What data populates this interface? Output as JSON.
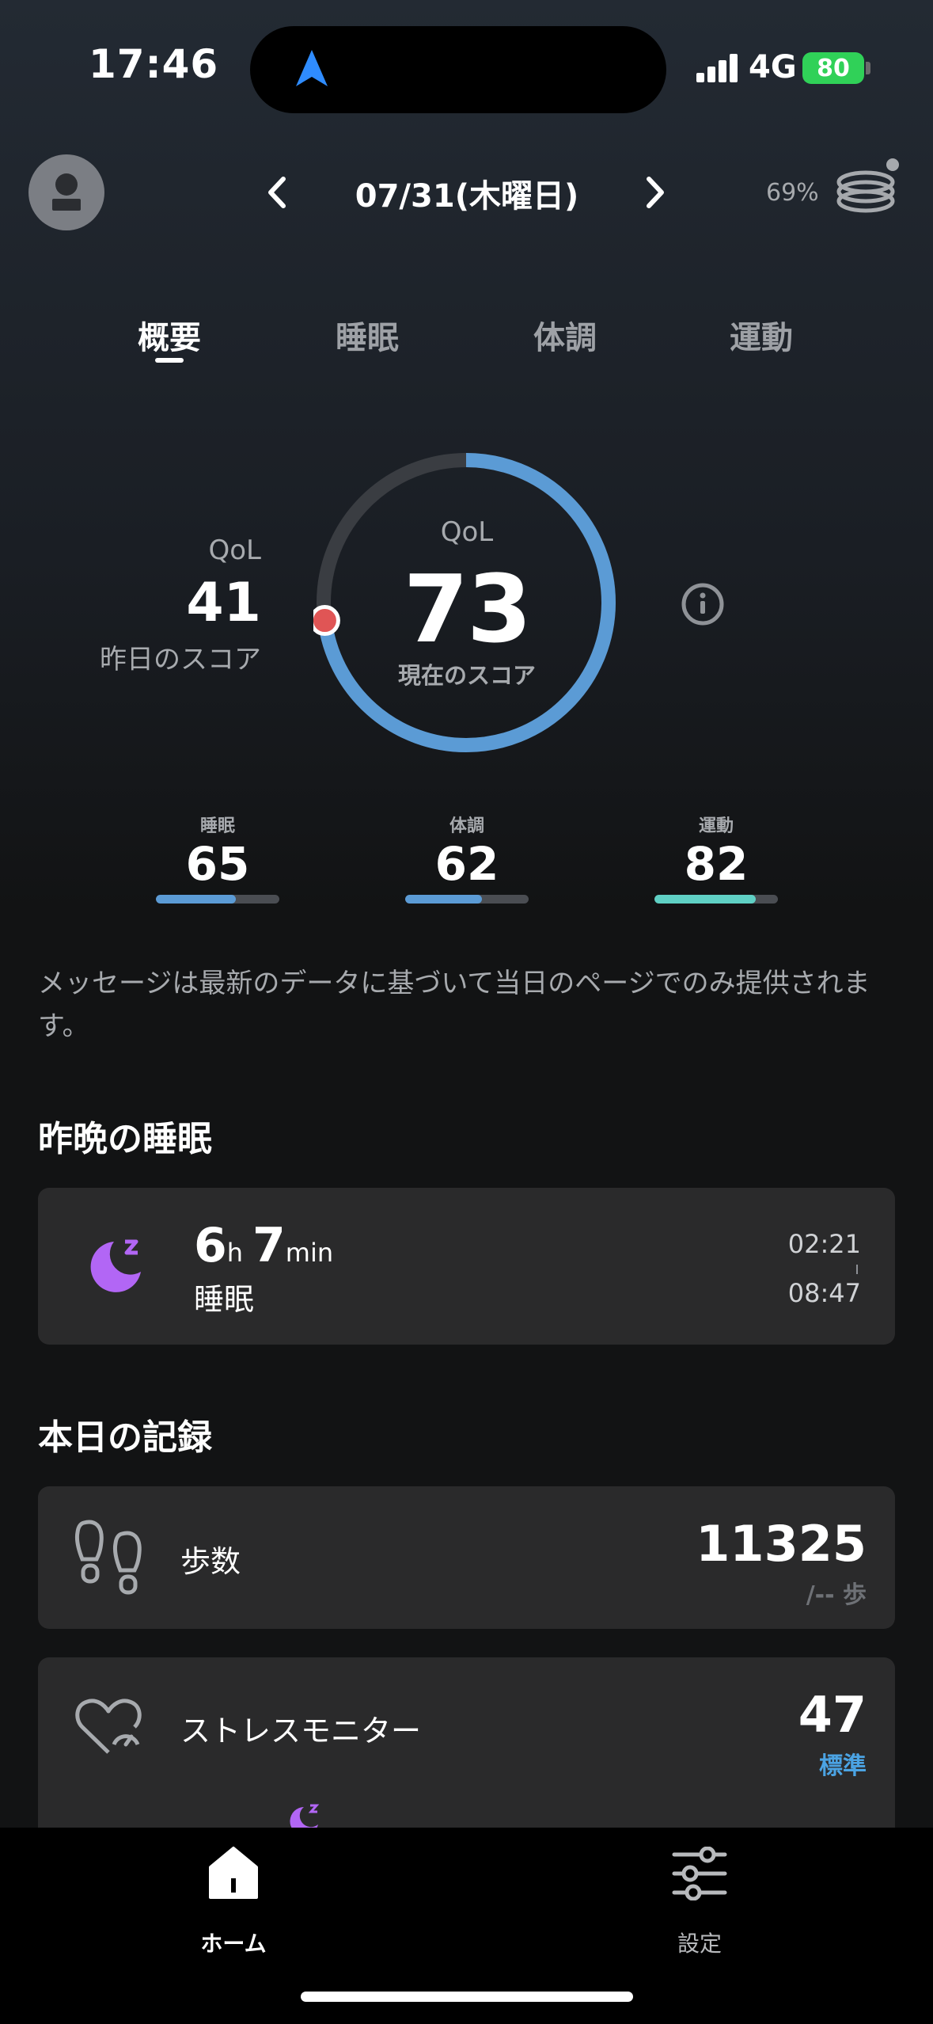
{
  "status_bar": {
    "time": "17:46",
    "network": "4G",
    "battery": "80"
  },
  "header": {
    "date": "07/31(木曜日)",
    "device_battery": "69%"
  },
  "tabs": [
    {
      "label": "概要",
      "active": true
    },
    {
      "label": "睡眠",
      "active": false
    },
    {
      "label": "体調",
      "active": false
    },
    {
      "label": "運動",
      "active": false
    }
  ],
  "score": {
    "yesterday_qol_label": "QoL",
    "yesterday_value": "41",
    "yesterday_label": "昨日のスコア",
    "current_qol_label": "QoL",
    "current_value": "73",
    "current_label": "現在のスコア",
    "ring_fraction": 0.73
  },
  "subscores": [
    {
      "label": "睡眠",
      "value": "65",
      "fraction": 0.65,
      "color": "#5b9bd5"
    },
    {
      "label": "体調",
      "value": "62",
      "fraction": 0.62,
      "color": "#5b9bd5"
    },
    {
      "label": "運動",
      "value": "82",
      "fraction": 0.82,
      "color": "#5fd0c4"
    }
  ],
  "message": "メッセージは最新のデータに基づいて当日のページでのみ提供されます。",
  "sleep_section": {
    "title": "昨晩の睡眠",
    "hours": "6",
    "hours_unit": "h",
    "minutes": "7",
    "minutes_unit": "min",
    "label": "睡眠",
    "start": "02:21",
    "end": "08:47"
  },
  "records_section": {
    "title": "本日の記録",
    "steps": {
      "label": "歩数",
      "value": "11325",
      "sub": "/-- 歩"
    },
    "stress": {
      "label": "ストレスモニター",
      "value": "47",
      "sub": "標準",
      "sub_color": "#4ba3e3"
    }
  },
  "nav": {
    "home": "ホーム",
    "settings": "設定"
  },
  "colors": {
    "accent_blue": "#5b9bd5",
    "teal": "#5fd0c4",
    "sleep_purple": "#b266f5",
    "marker_red": "#e05555"
  }
}
